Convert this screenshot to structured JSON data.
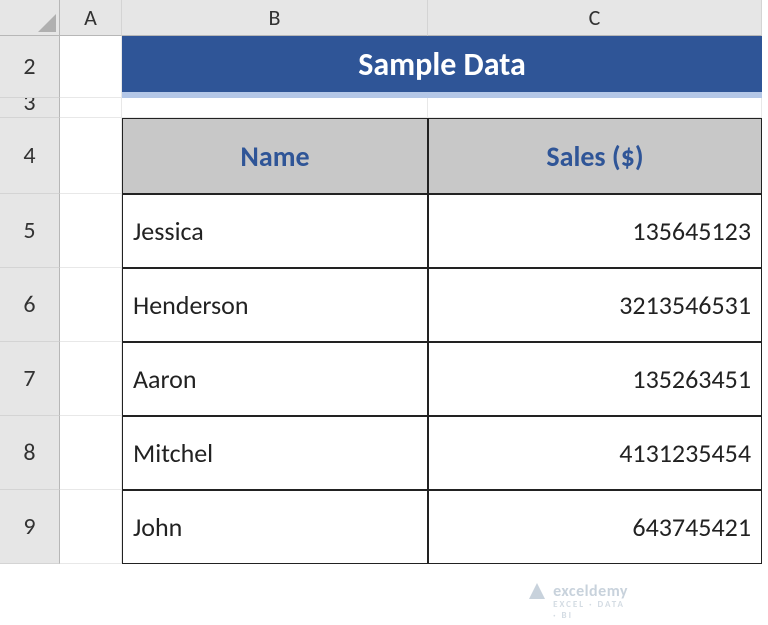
{
  "columns": {
    "A": "A",
    "B": "B",
    "C": "C"
  },
  "rows": {
    "2": "2",
    "3": "3",
    "4": "4",
    "5": "5",
    "6": "6",
    "7": "7",
    "8": "8",
    "9": "9"
  },
  "banner": {
    "title": "Sample Data"
  },
  "table": {
    "headers": {
      "name": "Name",
      "sales": "Sales ($)"
    },
    "rows": [
      {
        "name": "Jessica",
        "sales": "135645123"
      },
      {
        "name": "Henderson",
        "sales": "3213546531"
      },
      {
        "name": "Aaron",
        "sales": "135263451"
      },
      {
        "name": "Mitchel",
        "sales": "4131235454"
      },
      {
        "name": "John",
        "sales": "643745421"
      }
    ]
  },
  "watermark": {
    "brand": "exceldemy",
    "tag": "EXCEL · DATA · BI"
  },
  "chart_data": {
    "type": "table",
    "title": "Sample Data",
    "columns": [
      "Name",
      "Sales ($)"
    ],
    "rows": [
      [
        "Jessica",
        135645123
      ],
      [
        "Henderson",
        3213546531
      ],
      [
        "Aaron",
        135263451
      ],
      [
        "Mitchel",
        4131235454
      ],
      [
        "John",
        643745421
      ]
    ]
  }
}
